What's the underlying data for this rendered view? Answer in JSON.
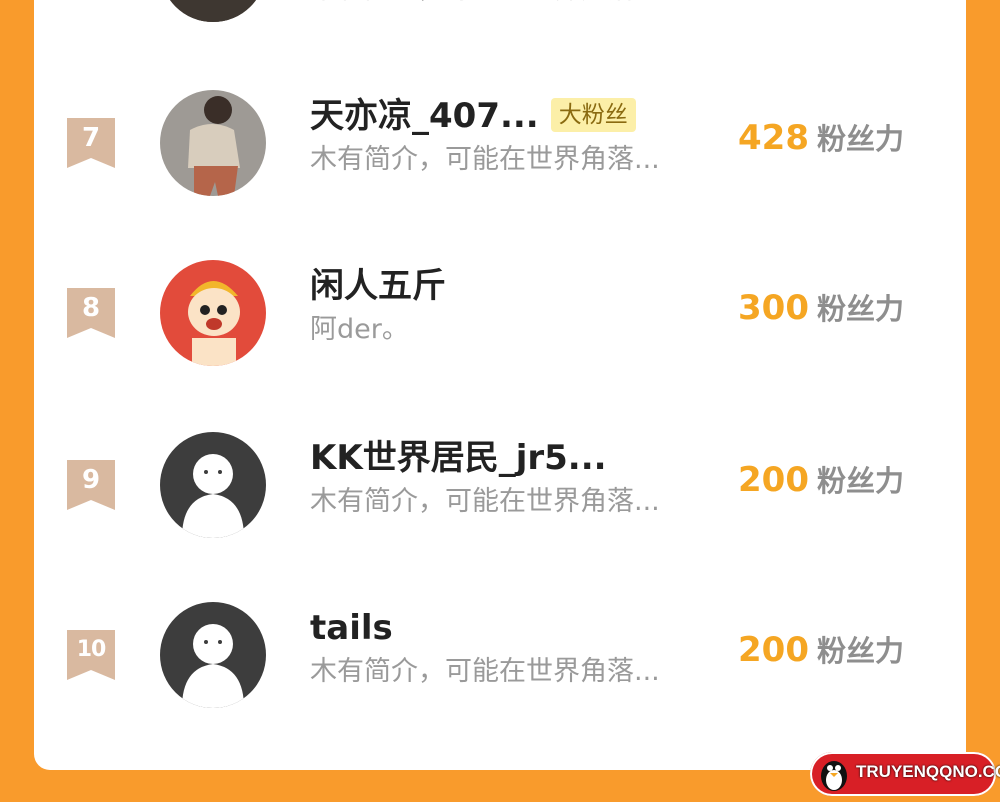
{
  "leaderboard": {
    "unit_label": "粉丝力",
    "partial_row": {
      "desc": "木有简介，可能在世界角落..."
    },
    "rows": [
      {
        "rank": "7",
        "name": "天亦凉_407...",
        "badge": "大粉丝",
        "desc": "木有简介，可能在世界角落...",
        "score": "428",
        "avatar_icon": "person-photo-avatar"
      },
      {
        "rank": "8",
        "name": "闲人五斤",
        "desc": "阿der。",
        "score": "300",
        "avatar_icon": "cartoon-character-avatar"
      },
      {
        "rank": "9",
        "name": "KK世界居民_jr5...",
        "desc": "木有简介，可能在世界角落...",
        "score": "200",
        "avatar_icon": "default-user-avatar"
      },
      {
        "rank": "10",
        "name": "tails",
        "desc": "木有简介，可能在世界角落...",
        "score": "200",
        "avatar_icon": "default-user-avatar"
      }
    ]
  },
  "watermark": {
    "text": "TRUYENQQNO.COM",
    "icon": "penguin-icon"
  },
  "colors": {
    "background": "#F99B2C",
    "score": "#F5A623",
    "rank_ribbon": "#D9B9A0",
    "badge_bg": "#FCEFA8"
  }
}
